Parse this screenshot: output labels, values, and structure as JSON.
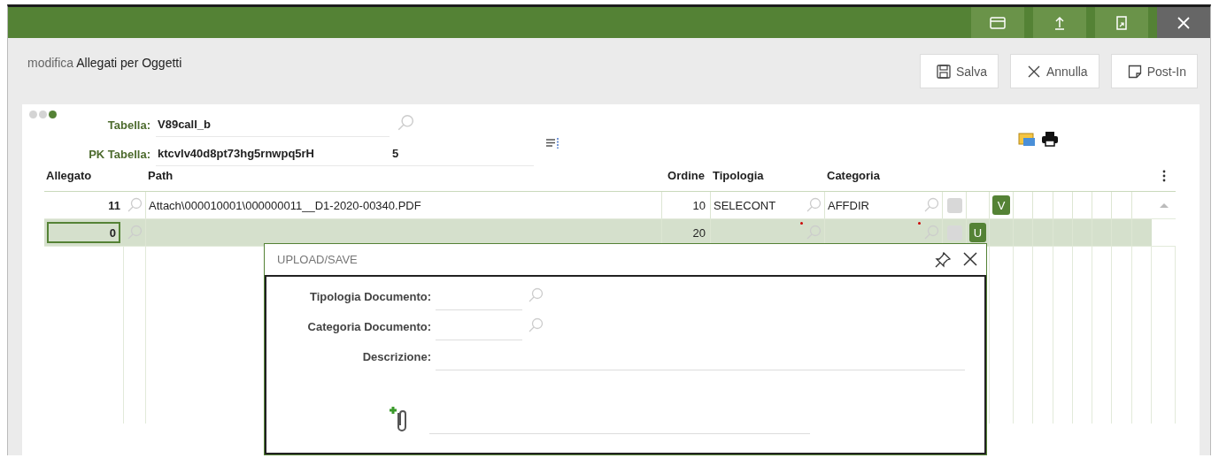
{
  "header": {
    "mode": "modifica",
    "title": "Allegati per Oggetti"
  },
  "toolbar": [
    {
      "label": "Salva",
      "kind": "save"
    },
    {
      "label": "Annulla",
      "kind": "cancel"
    },
    {
      "label": "Post-In",
      "kind": "note"
    }
  ],
  "steps": [
    {
      "on": false
    },
    {
      "on": false
    },
    {
      "on": true
    }
  ],
  "form": {
    "fields": [
      {
        "label": "Tabella:",
        "value": "V89call_b",
        "kind": "lookup"
      },
      {
        "label": "PK Tabella:",
        "value": "ktcvlv40d8pt73hg5rnwpq5rH",
        "extra": "5",
        "kind": "plain"
      }
    ]
  },
  "table": {
    "columns": [
      "Allegato",
      "Path",
      "Ordine",
      "Tipologia",
      "Categoria"
    ],
    "rows": [
      {
        "allegato": "11",
        "path": "Attach\\000010001\\000000011__D1-2020-00340.PDF",
        "ordine": "10",
        "tipologia": "SELECONT",
        "categoria": "AFFDIR",
        "checked": false,
        "column_9": "V",
        "selected": false,
        "required": false
      },
      {
        "allegato": "0",
        "ordine": "20",
        "checked": false,
        "column_8": "U",
        "selected": true,
        "required": true
      }
    ]
  },
  "popup": {
    "title": "UPLOAD/SAVE",
    "fields": [
      {
        "label": "Tipologia Documento:",
        "kind": "lookup"
      },
      {
        "label": "Categoria Documento:",
        "kind": "lookup"
      },
      {
        "label": "Descrizione:",
        "kind": "text"
      }
    ]
  }
}
